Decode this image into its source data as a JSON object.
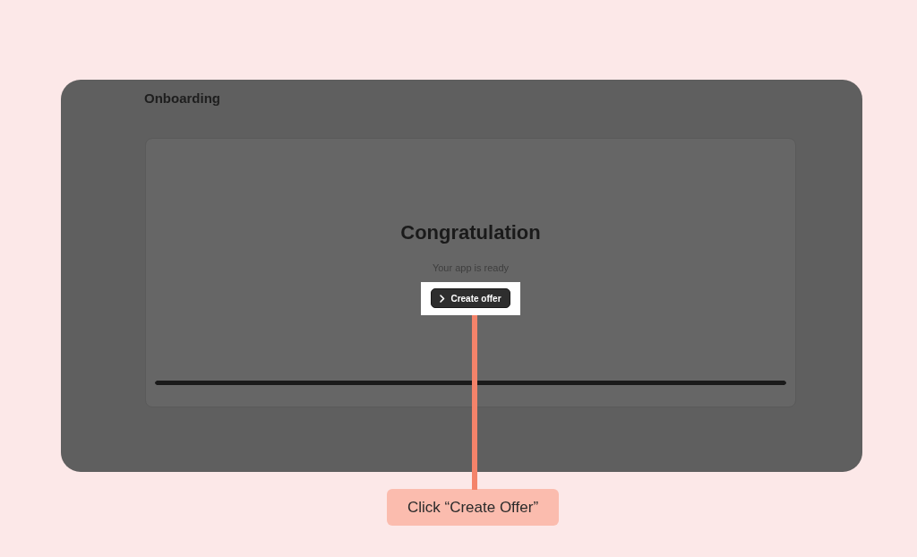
{
  "header": {
    "title": "Onboarding"
  },
  "card": {
    "title": "Congratulation",
    "subtitle": "Your app is ready",
    "button": {
      "label": "Create offer",
      "highlighted": true
    },
    "progress": {
      "level": 1
    }
  },
  "callout": {
    "text": "Click “Create Offer”"
  }
}
